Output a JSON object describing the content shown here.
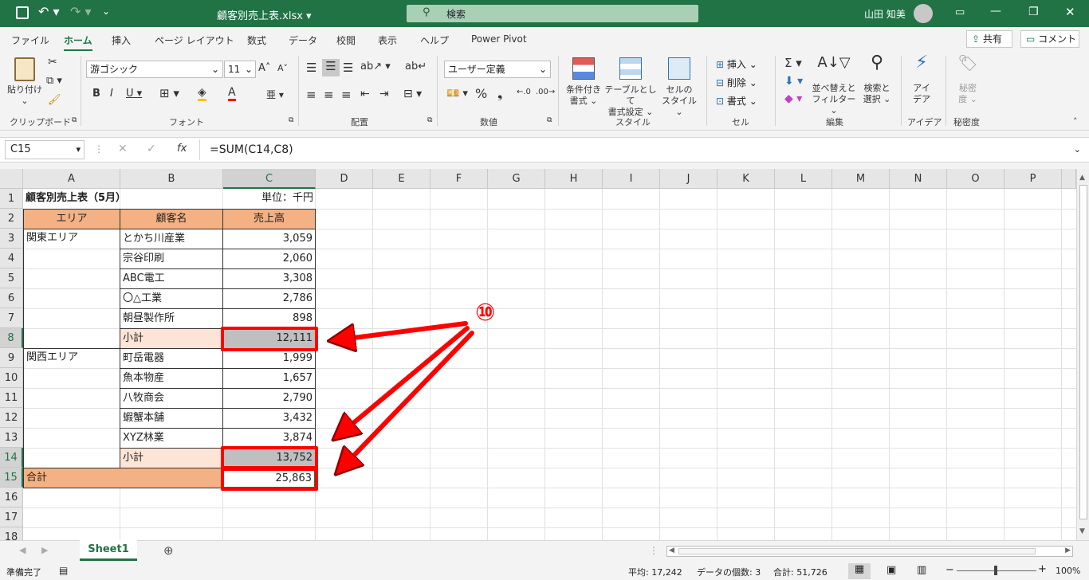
{
  "title": {
    "filename": "顧客別売上表.xlsx ▾",
    "search": "検索",
    "user": "山田 知美"
  },
  "tabs": [
    "ファイル",
    "ホーム",
    "挿入",
    "ページ レイアウト",
    "数式",
    "データ",
    "校閲",
    "表示",
    "ヘルプ",
    "Power Pivot"
  ],
  "share": "共有",
  "comment": "コメント",
  "ribbon": {
    "paste": "貼り付け",
    "font_name": "游ゴシック",
    "font_size": "11",
    "number_format": "ユーザー定義",
    "cond_format": [
      "条件付き",
      "書式"
    ],
    "table_format": [
      "テーブルとして",
      "書式設定"
    ],
    "cell_style": [
      "セルの",
      "スタイル"
    ],
    "insert": "挿入",
    "delete": "削除",
    "format": "書式",
    "sort": [
      "並べ替えと",
      "フィルター"
    ],
    "find": [
      "検索と",
      "選択"
    ],
    "ideas": [
      "アイ",
      "デア"
    ],
    "sensitivity": [
      "秘密",
      "度"
    ],
    "groups": {
      "clipboard": "クリップボード",
      "font": "フォント",
      "align": "配置",
      "number": "数値",
      "style": "スタイル",
      "cells": "セル",
      "edit": "編集",
      "ideas": "アイデア",
      "sensitivity": "秘密度"
    }
  },
  "formula_bar": {
    "name_box": "C15",
    "fx": "fx",
    "formula": "=SUM(C14,C8)"
  },
  "columns": [
    "A",
    "B",
    "C",
    "D",
    "E",
    "F",
    "G",
    "H",
    "I",
    "J",
    "K",
    "L",
    "M",
    "N",
    "O",
    "P"
  ],
  "rows": [
    "1",
    "2",
    "3",
    "4",
    "5",
    "6",
    "7",
    "8",
    "9",
    "10",
    "11",
    "12",
    "13",
    "14",
    "15",
    "16",
    "17",
    "18"
  ],
  "sheet": {
    "title": "顧客別売上表（5月）",
    "unit": "単位：千円",
    "headers": [
      "エリア",
      "顧客名",
      "売上高"
    ],
    "kanto": "関東エリア",
    "kansai": "関西エリア",
    "customers": [
      {
        "name": "とかち川産業",
        "value": "3,059"
      },
      {
        "name": "宗谷印刷",
        "value": "2,060"
      },
      {
        "name": "ABC電工",
        "value": "3,308"
      },
      {
        "name": "〇△工業",
        "value": "2,786"
      },
      {
        "name": "朝昼製作所",
        "value": "898"
      },
      {
        "name": "小計",
        "value": "12,111"
      },
      {
        "name": "町岳電器",
        "value": "1,999"
      },
      {
        "name": "魚本物産",
        "value": "1,657"
      },
      {
        "name": "八牧商会",
        "value": "2,790"
      },
      {
        "name": "蝦蟹本舗",
        "value": "3,432"
      },
      {
        "name": "XYZ林業",
        "value": "3,874"
      },
      {
        "name": "小計",
        "value": "13,752"
      }
    ],
    "total_label": "合計",
    "total_value": "25,863"
  },
  "annotation": "⑩",
  "sheet_tab": "Sheet1",
  "status": {
    "ready": "準備完了",
    "average": "平均: 17,242",
    "count": "データの個数: 3",
    "sum": "合計: 51,726",
    "zoom": "100%"
  },
  "colors": {
    "accent": "#217346",
    "header_fill": "#f4b183",
    "subtotal_fill": "#fce4d6",
    "highlight": "#ff0000"
  }
}
